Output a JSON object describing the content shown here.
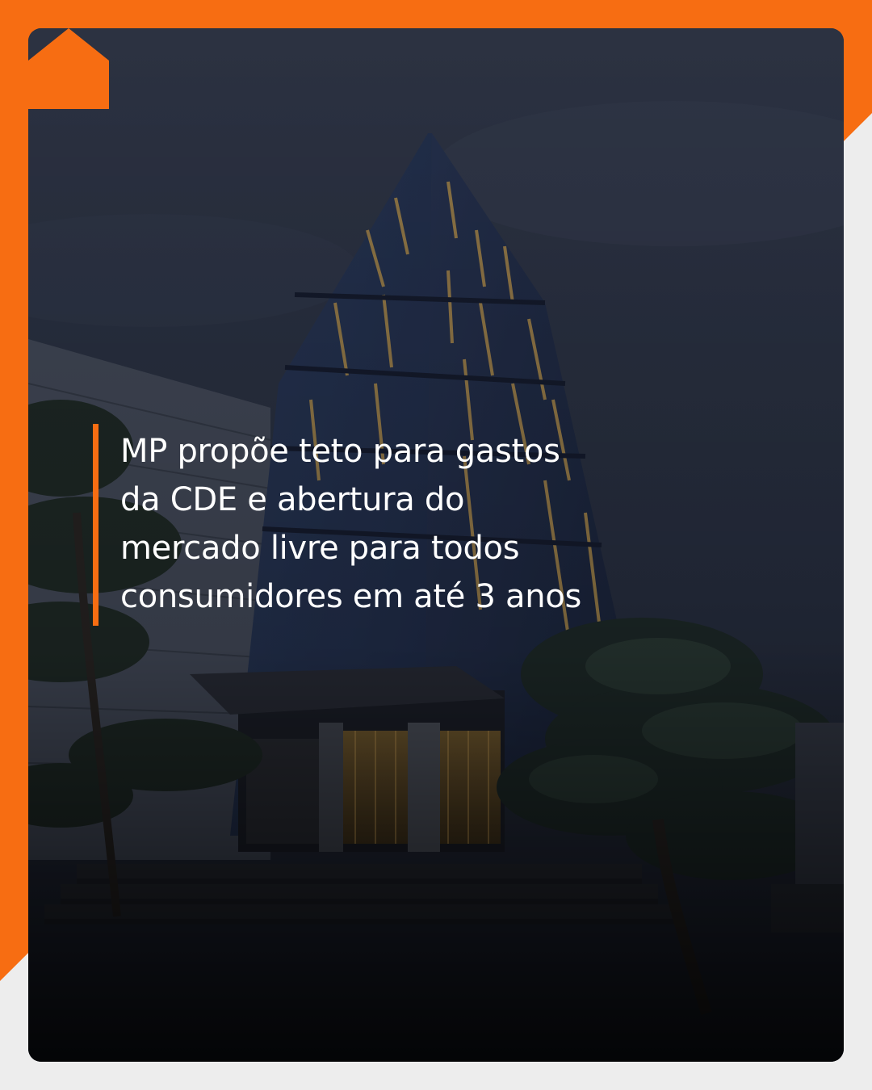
{
  "post": {
    "headline": "MP propõe teto para gastos da CDE e abertura do mercado livre para todos consumidores em até 3 anos"
  },
  "brand": {
    "accent_color": "#f76d12",
    "logo_icon": "house-icon"
  }
}
